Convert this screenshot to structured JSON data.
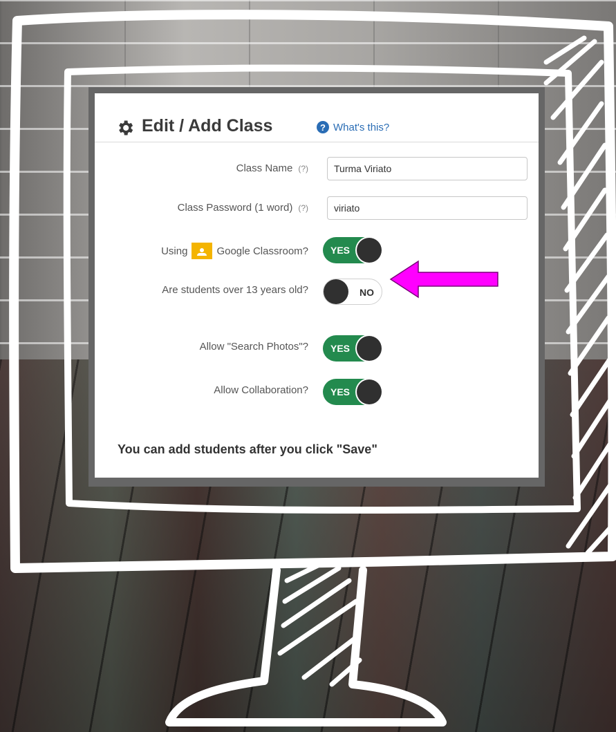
{
  "header": {
    "title": "Edit / Add Class",
    "help_link": "What's this?",
    "gear_icon": "gear-icon",
    "help_icon": "question-circle-icon"
  },
  "form": {
    "class_name": {
      "label": "Class Name",
      "hint": "(?)",
      "value": "Turma Viriato"
    },
    "class_password": {
      "label": "Class Password (1 word)",
      "hint": "(?)",
      "value": "viriato"
    },
    "google_classroom": {
      "label_prefix": "Using",
      "label_suffix": "Google Classroom?",
      "toggle": "YES",
      "icon": "google-classroom-icon"
    },
    "over_13": {
      "label": "Are students over 13 years old?",
      "toggle": "NO"
    },
    "search_photos": {
      "label": "Allow \"Search Photos\"?",
      "toggle": "YES"
    },
    "collaboration": {
      "label": "Allow Collaboration?",
      "toggle": "YES"
    }
  },
  "footer": {
    "note": "You can add students after you click \"Save\""
  },
  "colors": {
    "toggle_on": "#238a4e",
    "link": "#2a6db5",
    "arrow": "#ff00ff"
  }
}
